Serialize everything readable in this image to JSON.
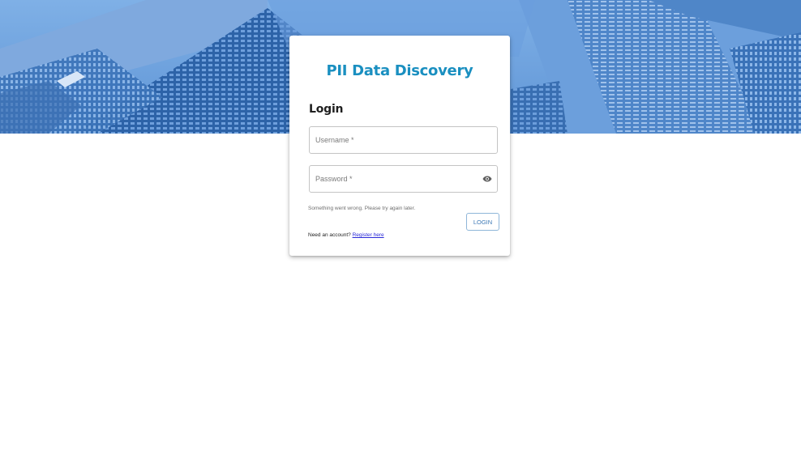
{
  "app": {
    "title": "PII Data Discovery"
  },
  "login": {
    "heading": "Login",
    "username": {
      "placeholder": "Username *",
      "value": ""
    },
    "password": {
      "placeholder": "Password *",
      "value": ""
    },
    "error_message": "Something went wrong. Please try again later.",
    "submit_label": "LOGIN",
    "register_prompt": "Need an account?",
    "register_link": "Register here"
  },
  "colors": {
    "brand": "#1a8fc0",
    "hero_blue": "#5b8fcf",
    "link": "#2a2ad8"
  },
  "icons": {
    "password_toggle": "eye-icon"
  }
}
